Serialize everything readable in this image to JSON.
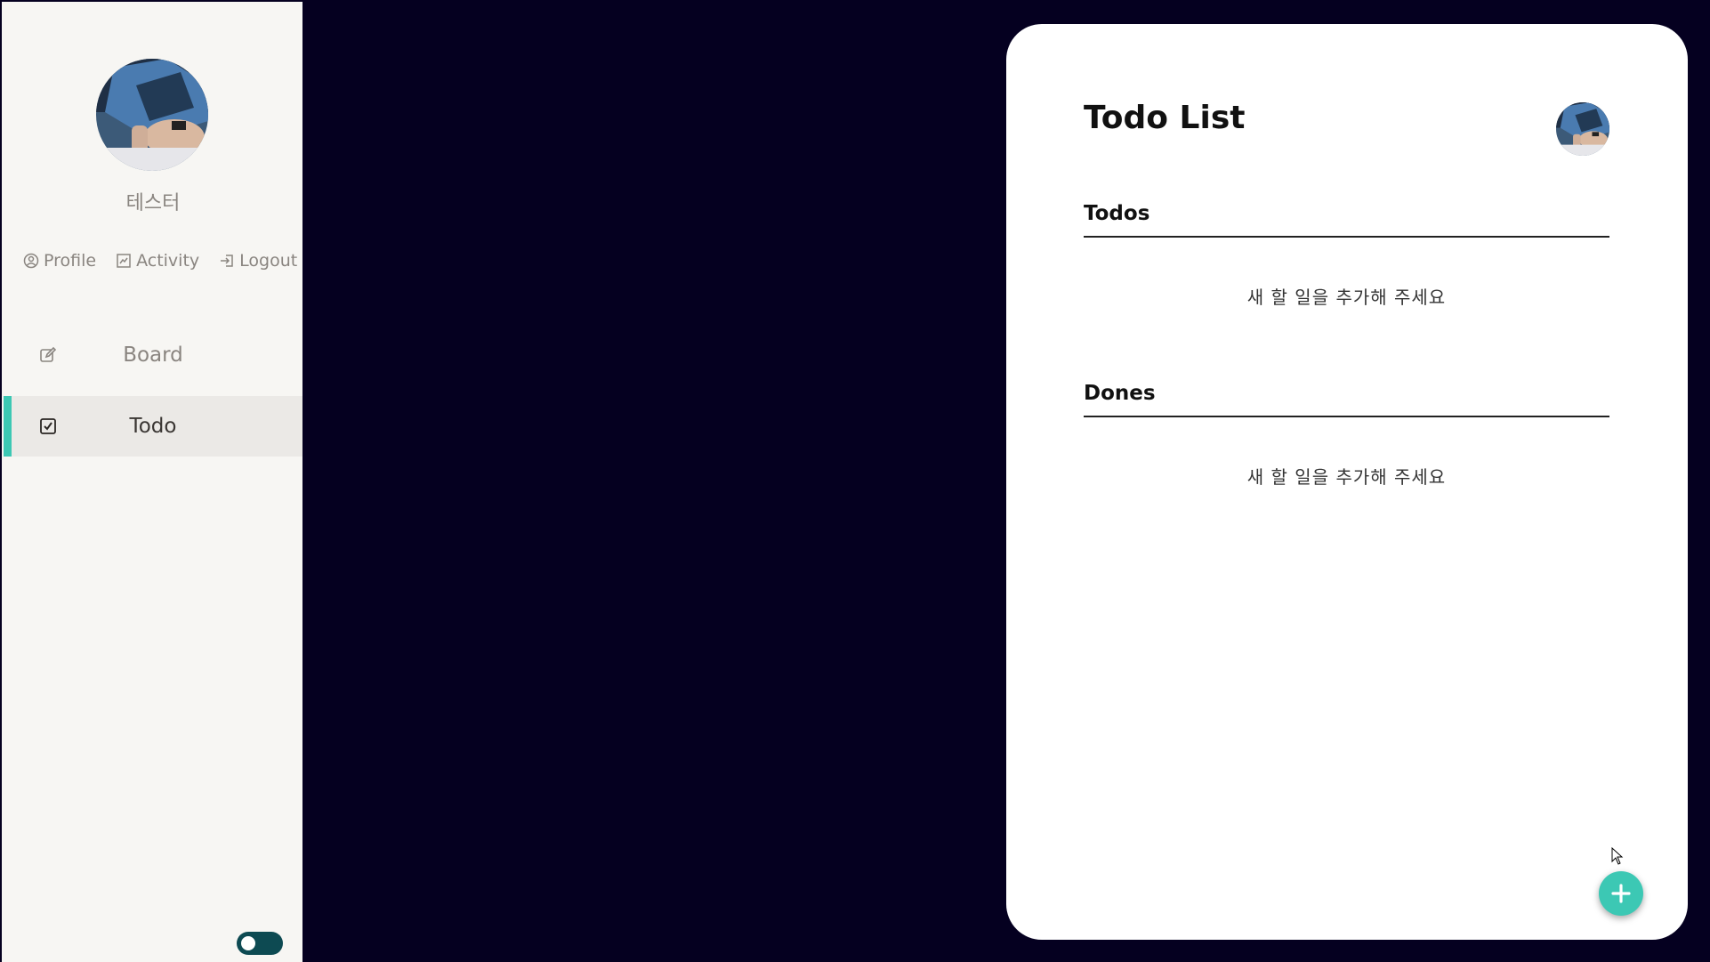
{
  "sidebar": {
    "user": {
      "name": "테스터"
    },
    "links": [
      {
        "label": "Profile",
        "icon": "user-circle-icon"
      },
      {
        "label": "Activity",
        "icon": "activity-icon"
      },
      {
        "label": "Logout",
        "icon": "logout-icon"
      }
    ],
    "nav": [
      {
        "label": "Board",
        "icon": "edit-icon",
        "active": false
      },
      {
        "label": "Todo",
        "icon": "checkbox-icon",
        "active": true
      }
    ],
    "theme_toggle": {
      "on": false
    }
  },
  "main": {
    "title": "Todo List",
    "sections": [
      {
        "title": "Todos",
        "empty_message": "새 할 일을 추가해 주세요"
      },
      {
        "title": "Dones",
        "empty_message": "새 할 일을 추가해 주세요"
      }
    ],
    "fab_icon": "plus-icon"
  },
  "colors": {
    "background": "#050020",
    "sidebar_bg": "#f7f6f3",
    "accent": "#3cc8b4",
    "toggle": "#0d4a52",
    "active_nav_bg": "#ebe9e6"
  }
}
